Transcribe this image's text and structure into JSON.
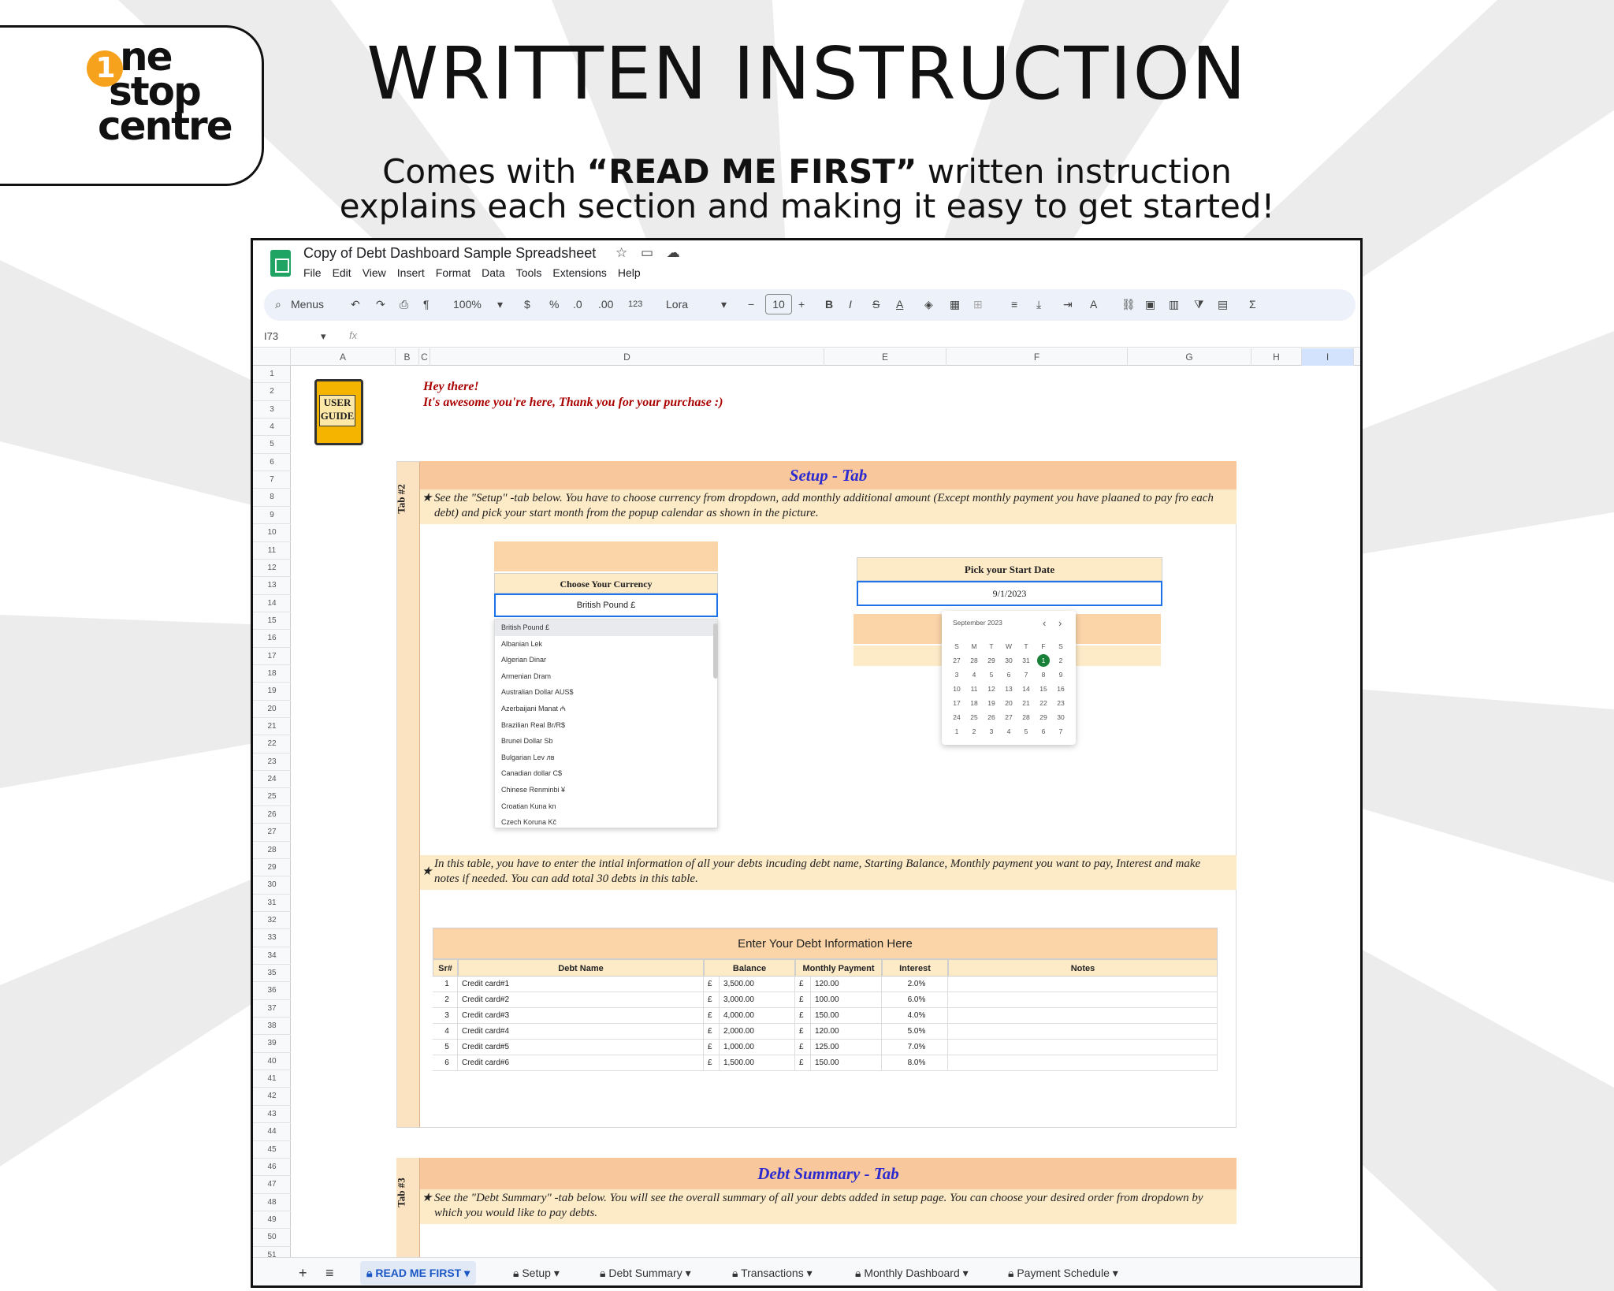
{
  "brand": {
    "logo_one": "1",
    "logo_line1": "ne",
    "logo_line2": "stop",
    "logo_line3": "centre"
  },
  "header": {
    "title": "WRITTEN INSTRUCTION",
    "sub_pre": "Comes with ",
    "sub_bold": "“READ ME FIRST”",
    "sub_post": " written instruction",
    "sub_line2": "explains each section and making it easy to get started!"
  },
  "sheet": {
    "doc_title": "Copy of Debt Dashboard Sample Spreadsheet",
    "menus": [
      "File",
      "Edit",
      "View",
      "Insert",
      "Format",
      "Data",
      "Tools",
      "Extensions",
      "Help"
    ],
    "toolbar": {
      "search": "Menus",
      "zoom": "100%",
      "dollar": "$",
      "percent": "%",
      "dec_minus": ".0",
      "dec_plus": ".00",
      "num": "123",
      "font": "Lora",
      "size": "10",
      "minus": "−",
      "plus": "+",
      "bold": "B",
      "italic": "I",
      "strike": "S",
      "underline": "A",
      "sigma": "Σ"
    },
    "cell_ref": "I73",
    "fx": "fx",
    "columns": [
      "A",
      "B",
      "C",
      "D",
      "E",
      "F",
      "G",
      "H",
      "I"
    ],
    "rows": [
      "1",
      "2",
      "3",
      "4",
      "5",
      "6",
      "7",
      "8",
      "9",
      "10",
      "11",
      "12",
      "13",
      "14",
      "15",
      "16",
      "17",
      "18",
      "19",
      "20",
      "21",
      "22",
      "23",
      "24",
      "25",
      "26",
      "27",
      "28",
      "29",
      "30",
      "31",
      "32",
      "33",
      "34",
      "35",
      "36",
      "37",
      "38",
      "39",
      "40",
      "41",
      "42",
      "43",
      "44",
      "45",
      "46",
      "47",
      "48",
      "49",
      "50",
      "51"
    ],
    "user_guide": "USER GUIDE",
    "hey": "Hey there!",
    "thanks": "It's awesome you're here, Thank you for your purchase :)",
    "setup": {
      "tab_label": "Tab #2",
      "heading": "Setup - Tab",
      "note": "See the \"Setup\" -tab below.  You have to choose currency from dropdown,  add monthly additional amount (Except monthly payment you have plaaned to pay fro each debt) and pick your start month from the popup calendar as shown in the picture.",
      "currency_header": "Choose Your Currency",
      "currency_value": "British Pound £",
      "currencies": [
        "British Pound £",
        "Albanian Lek",
        "Algerian Dinar",
        "Armenian Dram",
        "Australian Dollar AUS$",
        "Azerbaijani Manat ₼",
        "Brazilian Real Br/R$",
        "Brunei Dollar Sb",
        "Bulgarian Lev лв",
        "Canadian dollar C$",
        "Chinese Renminbi ¥",
        "Croatian Kuna kn",
        "Czech Koruna Kč"
      ],
      "date_header": "Pick your Start Date",
      "date_value": "9/1/2023",
      "calendar": {
        "month": "September 2023",
        "prev": "‹",
        "next": "›",
        "weekdays": [
          "S",
          "M",
          "T",
          "W",
          "T",
          "F",
          "S"
        ],
        "days": [
          "27",
          "28",
          "29",
          "30",
          "31",
          "1",
          "2",
          "3",
          "4",
          "5",
          "6",
          "7",
          "8",
          "9",
          "10",
          "11",
          "12",
          "13",
          "14",
          "15",
          "16",
          "17",
          "18",
          "19",
          "20",
          "21",
          "22",
          "23",
          "24",
          "25",
          "26",
          "27",
          "28",
          "29",
          "30",
          "1",
          "2",
          "3",
          "4",
          "5",
          "6",
          "7"
        ],
        "selected": "1"
      },
      "note2": "In this table, you have to enter the intial information of all your debts incuding debt name, Starting Balance, Monthly payment you want to pay, Interest and make notes if needed. You can add total 30 debts in this table.",
      "table_title": "Enter Your Debt Information Here",
      "table_headers": [
        "Sr#",
        "Debt Name",
        "Balance",
        "Monthly Payment",
        "Interest",
        "Notes"
      ],
      "table_rows": [
        [
          "1",
          "Credit card#1",
          "£",
          "3,500.00",
          "£",
          "120.00",
          "2.0%"
        ],
        [
          "2",
          "Credit card#2",
          "£",
          "3,000.00",
          "£",
          "100.00",
          "6.0%"
        ],
        [
          "3",
          "Credit card#3",
          "£",
          "4,000.00",
          "£",
          "150.00",
          "4.0%"
        ],
        [
          "4",
          "Credit card#4",
          "£",
          "2,000.00",
          "£",
          "120.00",
          "5.0%"
        ],
        [
          "5",
          "Credit card#5",
          "£",
          "1,000.00",
          "£",
          "125.00",
          "7.0%"
        ],
        [
          "6",
          "Credit card#6",
          "£",
          "1,500.00",
          "£",
          "150.00",
          "8.0%"
        ]
      ]
    },
    "summary": {
      "tab_label": "Tab #3",
      "heading": "Debt Summary - Tab",
      "note": "See the \"Debt Summary\" -tab below. You will see the overall summary of all your debts added in setup page. You can choose your desired order from dropdown by which you would like to pay debts."
    },
    "tabs": [
      "READ ME FIRST",
      "Setup",
      "Debt Summary",
      "Transactions",
      "Monthly Dashboard",
      "Payment Schedule"
    ],
    "add_sheet": "+",
    "all_sheets": "≡"
  }
}
